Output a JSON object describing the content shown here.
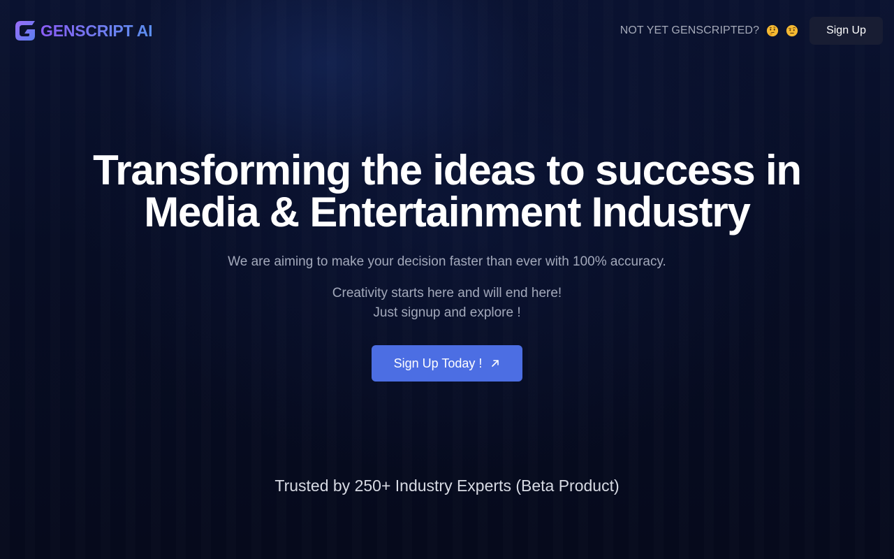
{
  "nav": {
    "brand_name": "GENSCRIPT AI",
    "brand_logo_icon": "genscript-g-logo-icon",
    "prompt_text": "NOT YET GENSCRIPTED?",
    "prompt_emojis": [
      "thinking-face-emoji-icon",
      "face-with-raised-eyebrow-emoji-icon"
    ],
    "signup_label": "Sign Up"
  },
  "hero": {
    "title_line1": "Transforming the ideas to success in",
    "title_line2": "Media & Entertainment Industry",
    "subtitle": "We are aiming to make your decision faster than ever with 100% accuracy.",
    "note_line1": "Creativity starts here and will end here!",
    "note_line2": "Just signup and explore !",
    "cta_label": "Sign Up Today !",
    "cta_icon": "arrow-up-right-icon"
  },
  "footer": {
    "trusted_text": "Trusted by 250+ Industry Experts (Beta Product)"
  },
  "colors": {
    "background": "#060b1e",
    "brand_gradient_start": "#8b5cf6",
    "brand_gradient_end": "#5b8ef0",
    "cta_background": "#4c6ee3",
    "nav_button_background": "#181d33",
    "muted_text": "#a3a9bb"
  }
}
